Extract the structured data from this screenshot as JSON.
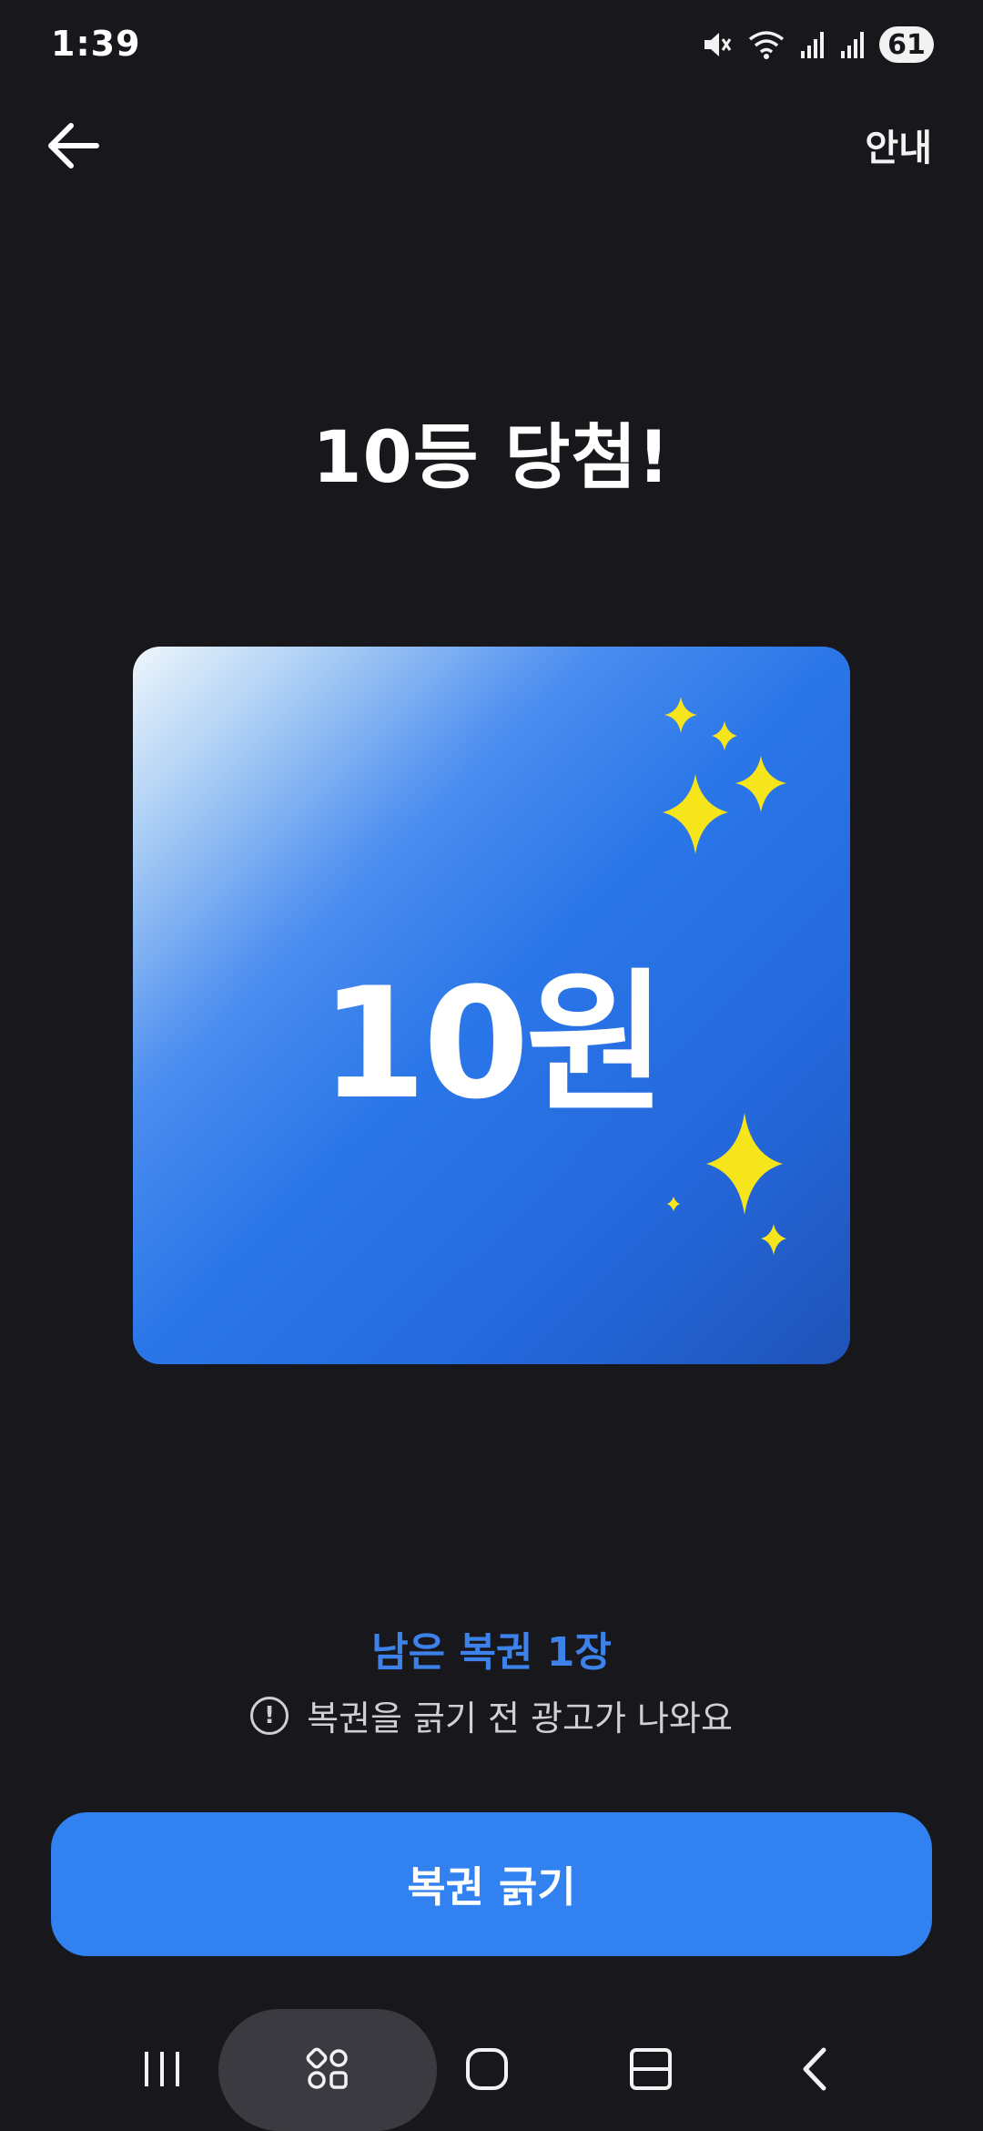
{
  "status_bar": {
    "time": "1:39",
    "battery": "61",
    "icons": [
      "mute-icon",
      "wifi-icon",
      "signal-icon",
      "signal-icon"
    ]
  },
  "top_bar": {
    "back_icon": "arrow-left-icon",
    "info_label": "안내"
  },
  "result": {
    "title": "10등 당첨!",
    "prize_amount": "10원"
  },
  "remaining": {
    "text": "남은 복권 1장",
    "notice": "복권을 긁기 전 광고가 나와요",
    "notice_icon": "exclamation-circle-icon"
  },
  "action": {
    "button_label": "복권 긁기"
  },
  "navigation": {
    "items": [
      "recent-apps-icon",
      "apps-icon",
      "home-icon",
      "split-screen-icon",
      "back-icon"
    ]
  },
  "colors": {
    "background": "#18181c",
    "accent": "#3281f0",
    "accent_text": "#3d82ea",
    "sparkle": "#f7e51c"
  }
}
